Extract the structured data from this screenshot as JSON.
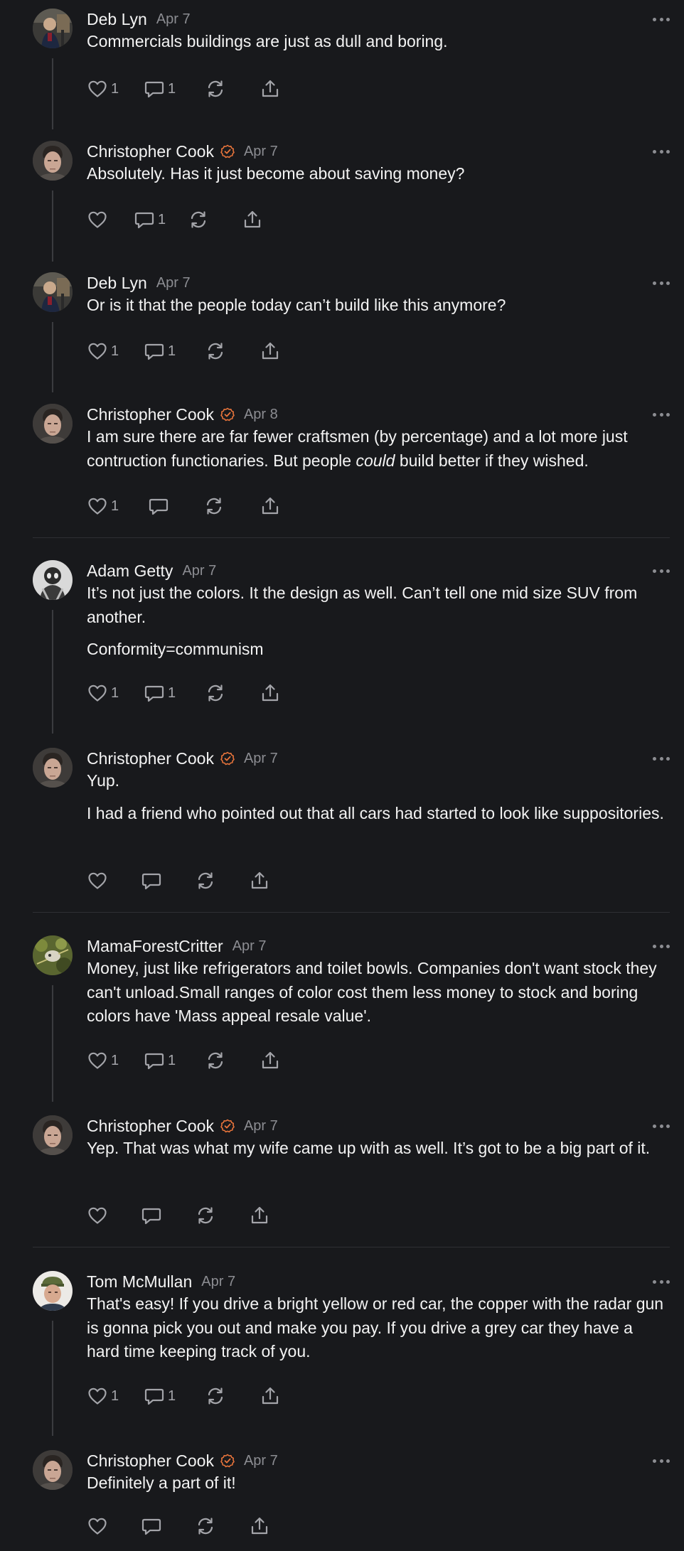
{
  "colors": {
    "background": "#18191c",
    "text": "#f3f3f3",
    "muted": "#8c8d92",
    "verified_accent": "#e8743b"
  },
  "comments": [
    {
      "author": "Deb Lyn",
      "date": "Apr 7",
      "verified": false,
      "avatar": "deb",
      "paragraphs": [
        "Commercials buildings are just as dull and boring."
      ],
      "likes": "1",
      "replies": "1"
    },
    {
      "author": "Christopher Cook",
      "date": "Apr 7",
      "verified": true,
      "avatar": "chris",
      "paragraphs": [
        "Absolutely. Has it just become about saving money?"
      ],
      "likes": "",
      "replies": "1"
    },
    {
      "author": "Deb Lyn",
      "date": "Apr 7",
      "verified": false,
      "avatar": "deb",
      "paragraphs": [
        "Or is it that the people today can’t build like this anymore?"
      ],
      "likes": "1",
      "replies": "1"
    },
    {
      "author": "Christopher Cook",
      "date": "Apr 8",
      "verified": true,
      "avatar": "chris",
      "paragraphs": [
        "I am sure there are far fewer craftsmen (by percentage) and a lot more just contruction functionaries. But people <em>could</em> build better if they wished."
      ],
      "likes": "1",
      "replies": ""
    },
    {
      "author": "Adam Getty",
      "date": "Apr 7",
      "verified": false,
      "avatar": "adam",
      "paragraphs": [
        "It’s not just the colors. It the design as well. Can’t tell one mid size SUV from another.",
        "Conformity=communism"
      ],
      "likes": "1",
      "replies": "1"
    },
    {
      "author": "Christopher Cook",
      "date": "Apr 7",
      "verified": true,
      "avatar": "chris",
      "paragraphs": [
        "Yup.",
        "I had a friend who pointed out that all cars had started to look like suppositories."
      ],
      "likes": "",
      "replies": ""
    },
    {
      "author": "MamaForestCritter",
      "date": "Apr 7",
      "verified": false,
      "avatar": "mama",
      "paragraphs": [
        "Money, just like refrigerators and toilet bowls. Companies don't want stock they can't unload.Small ranges of color cost them less money to stock and boring colors have 'Mass appeal resale value'."
      ],
      "likes": "1",
      "replies": "1"
    },
    {
      "author": "Christopher Cook",
      "date": "Apr 7",
      "verified": true,
      "avatar": "chris",
      "paragraphs": [
        "Yep. That was what my wife came up with as well. It’s got to be a big part of it."
      ],
      "likes": "",
      "replies": ""
    },
    {
      "author": "Tom McMullan",
      "date": "Apr 7",
      "verified": false,
      "avatar": "tom",
      "paragraphs": [
        "That's easy! If you drive a bright yellow or red car, the copper with the radar gun is gonna pick you out and make you pay. If you drive a grey car they have a hard time keeping track of you."
      ],
      "likes": "1",
      "replies": "1"
    },
    {
      "author": "Christopher Cook",
      "date": "Apr 7",
      "verified": true,
      "avatar": "chris",
      "paragraphs": [
        "Definitely a part of it!"
      ],
      "likes": "",
      "replies": ""
    }
  ]
}
